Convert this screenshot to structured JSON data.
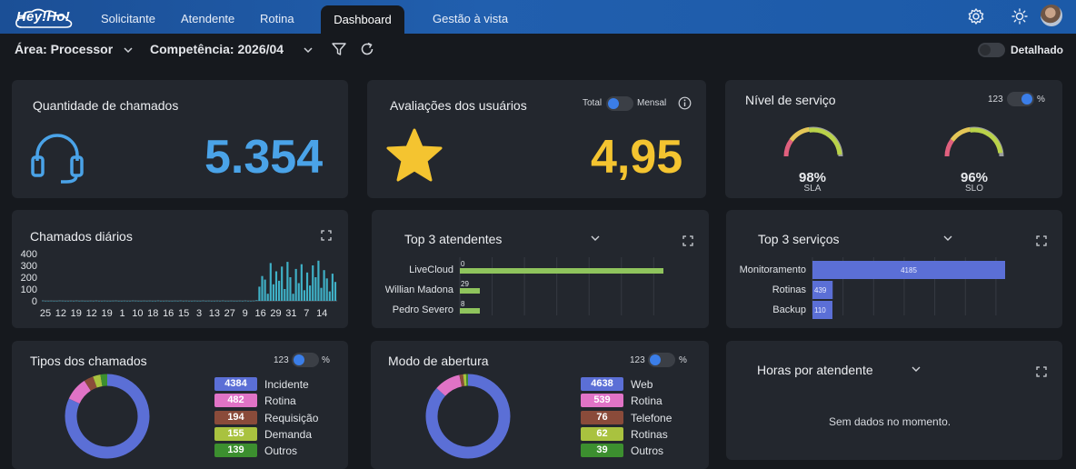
{
  "nav": {
    "logo": "Hey!Ho!",
    "items": [
      "Solicitante",
      "Atendente",
      "Rotina"
    ],
    "active": "Dashboard",
    "last": "Gestão à vista"
  },
  "filters": {
    "area": "Área: Processor",
    "competencia": "Competência: 2026/04",
    "detalhado": "Detalhado"
  },
  "cards": {
    "quantidade": {
      "title": "Quantidade de chamados",
      "value": "5.354"
    },
    "avaliacoes": {
      "title": "Avaliações dos usuários",
      "value": "4,95",
      "toggle_left": "Total",
      "toggle_right": "Mensal"
    },
    "nivel": {
      "title": "Nível de serviço",
      "toggle_left": "123",
      "toggle_right": "%",
      "gauges": [
        {
          "value": "98%",
          "label": "SLA",
          "fraction": 0.98
        },
        {
          "value": "96%",
          "label": "SLO",
          "fraction": 0.96
        }
      ]
    },
    "diarios": {
      "title": "Chamados diários"
    },
    "top_atendentes": {
      "title": "Top 3 atendentes"
    },
    "top_servicos": {
      "title": "Top 3 serviços"
    },
    "tipos": {
      "title": "Tipos dos chamados",
      "toggle_left": "123",
      "toggle_right": "%",
      "legend": [
        {
          "value": "4384",
          "label": "Incidente",
          "color": "#5b6fd6"
        },
        {
          "value": "482",
          "label": "Rotina",
          "color": "#e073c6"
        },
        {
          "value": "194",
          "label": "Requisição",
          "color": "#8a4b3a"
        },
        {
          "value": "155",
          "label": "Demanda",
          "color": "#a9c23f"
        },
        {
          "value": "139",
          "label": "Outros",
          "color": "#3c8f2f"
        }
      ]
    },
    "modo": {
      "title": "Modo de abertura",
      "toggle_left": "123",
      "toggle_right": "%",
      "legend": [
        {
          "value": "4638",
          "label": "Web",
          "color": "#5b6fd6"
        },
        {
          "value": "539",
          "label": "Rotina",
          "color": "#e073c6"
        },
        {
          "value": "76",
          "label": "Telefone",
          "color": "#8a4b3a"
        },
        {
          "value": "62",
          "label": "Rotinas",
          "color": "#a9c23f"
        },
        {
          "value": "39",
          "label": "Outros",
          "color": "#3c8f2f"
        }
      ]
    },
    "horas": {
      "title": "Horas por atendente",
      "empty": "Sem dados no momento."
    }
  },
  "chart_data": [
    {
      "type": "bar",
      "title": "Chamados diários",
      "ylim": [
        0,
        400
      ],
      "yticks": [
        "400",
        "300",
        "200",
        "100",
        "0"
      ],
      "x_tick_labels": [
        "25",
        "12",
        "19",
        "12",
        "19",
        "1",
        "10",
        "18",
        "16",
        "15",
        "3",
        "13",
        "27",
        "9",
        "16",
        "29",
        "31",
        "7",
        "14"
      ],
      "values": [
        2,
        0,
        0,
        1,
        0,
        0,
        2,
        1,
        0,
        0,
        1,
        0,
        2,
        0,
        1,
        0,
        0,
        1,
        0,
        2,
        0,
        0,
        1,
        0,
        0,
        1,
        2,
        0,
        0,
        1,
        0,
        0,
        2,
        1,
        0,
        0,
        1,
        0,
        1,
        0,
        0,
        2,
        0,
        0,
        1,
        0,
        0,
        1,
        0,
        2,
        0,
        1,
        0,
        0,
        1,
        0,
        0,
        2,
        0,
        1,
        0,
        0,
        1,
        0,
        2,
        0,
        0,
        1,
        0,
        0,
        1,
        0,
        2,
        0,
        0,
        1,
        5,
        120,
        210,
        180,
        60,
        320,
        140,
        250,
        170,
        290,
        100,
        330,
        200,
        60,
        270,
        150,
        310,
        90,
        240,
        130,
        300,
        200,
        340,
        110,
        260,
        190,
        80,
        230,
        160
      ]
    },
    {
      "type": "bar",
      "title": "Top 3 atendentes",
      "orientation": "horizontal",
      "categories": [
        "LiveCloud",
        "Willian Madona",
        "Pedro Severo"
      ],
      "values": [
        4410,
        112,
        94
      ],
      "labels": [
        "0",
        "29",
        "8"
      ],
      "color": "#8fc45d"
    },
    {
      "type": "bar",
      "title": "Top 3 serviços",
      "orientation": "horizontal",
      "categories": [
        "Monitoramento",
        "Rotinas",
        "Backup"
      ],
      "values": [
        4185,
        439,
        110
      ],
      "labels": [
        "4185",
        "439",
        "110"
      ],
      "color": "#5b6fd6"
    },
    {
      "type": "pie",
      "title": "Tipos dos chamados",
      "categories": [
        "Incidente",
        "Rotina",
        "Requisição",
        "Demanda",
        "Outros"
      ],
      "values": [
        4384,
        482,
        194,
        155,
        139
      ]
    },
    {
      "type": "pie",
      "title": "Modo de abertura",
      "categories": [
        "Web",
        "Rotina",
        "Telefone",
        "Rotinas",
        "Outros"
      ],
      "values": [
        4638,
        539,
        76,
        62,
        39
      ]
    }
  ]
}
